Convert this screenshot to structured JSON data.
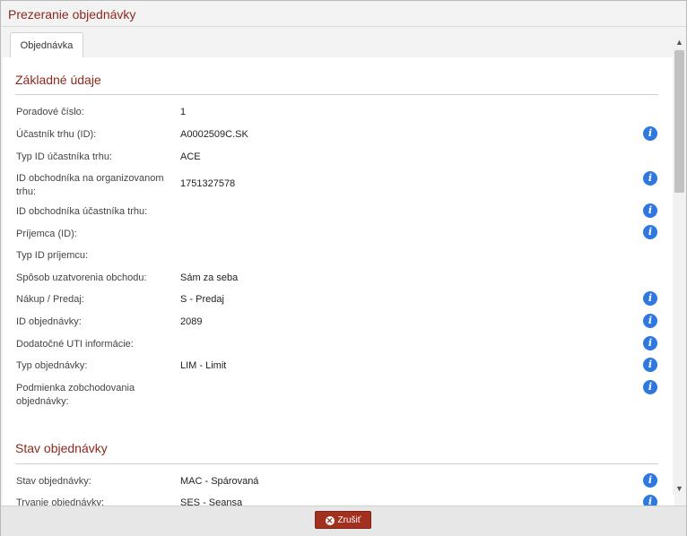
{
  "dialog": {
    "title": "Prezeranie objednávky"
  },
  "tabs": [
    {
      "label": "Objednávka"
    }
  ],
  "sections": {
    "basic": {
      "title": "Základné údaje",
      "rows": [
        {
          "label": "Poradové číslo:",
          "value": "1"
        },
        {
          "label": "Účastník trhu (ID):",
          "value": "A0002509C.SK"
        },
        {
          "label": "Typ ID účastníka trhu:",
          "value": "ACE"
        },
        {
          "label": "ID obchodníka na organizovanom trhu:",
          "value": "1751327578"
        },
        {
          "label": "ID obchodníka účastníka trhu:",
          "value": ""
        },
        {
          "label": "Príjemca (ID):",
          "value": ""
        },
        {
          "label": "Typ ID príjemcu:",
          "value": ""
        },
        {
          "label": "Spôsob uzatvorenia obchodu:",
          "value": "Sám za seba"
        },
        {
          "label": "Nákup / Predaj:",
          "value": "S - Predaj"
        },
        {
          "label": "ID objednávky:",
          "value": "2089"
        },
        {
          "label": "Dodatočné UTI informácie:",
          "value": ""
        },
        {
          "label": "Typ objednávky:",
          "value": "LIM - Limit"
        },
        {
          "label": "Podmienka zobchodovania objednávky:",
          "value": ""
        }
      ]
    },
    "status": {
      "title": "Stav objednávky",
      "rows": [
        {
          "label": "Stav objednávky:",
          "value": "MAC - Spárovaná"
        },
        {
          "label": "Trvanie objednávky:",
          "value": "SES - Seansa"
        }
      ]
    }
  },
  "icons": {
    "info": "info-icon",
    "cancel": "close-circle-icon"
  },
  "footer": {
    "cancel_label": "Zrušiť"
  },
  "colors": {
    "accent": "#8b2a1e",
    "button": "#a3301f",
    "info": "#2f78e0"
  }
}
